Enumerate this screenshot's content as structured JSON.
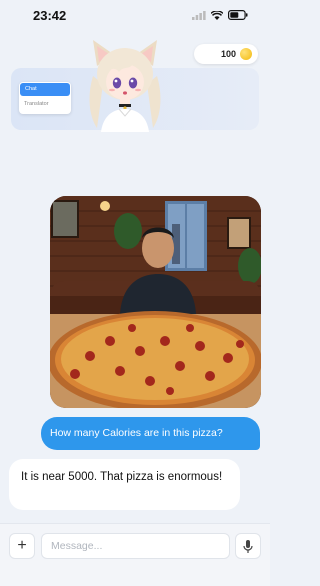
{
  "status_bar": {
    "time": "23:42"
  },
  "coins": {
    "count": "100",
    "icon": "coin-icon"
  },
  "mode_menu": {
    "items": [
      {
        "label": "Chat",
        "active": true
      },
      {
        "label": "Translator",
        "active": false
      }
    ]
  },
  "avatar": {
    "icon": "anime-cat-girl-avatar"
  },
  "messages": [
    {
      "role": "user",
      "type": "image",
      "icon": "pizza-photo"
    },
    {
      "role": "user",
      "type": "text",
      "text": "How many Calories are in this pizza?"
    },
    {
      "role": "assistant",
      "type": "text",
      "text": "It is near 5000. That pizza is enormous!"
    }
  ],
  "composer": {
    "placeholder": "Message...",
    "plus_icon": "plus-icon",
    "mic_icon": "microphone-icon"
  },
  "colors": {
    "accent": "#2e97ec",
    "background": "#eef2f8"
  }
}
